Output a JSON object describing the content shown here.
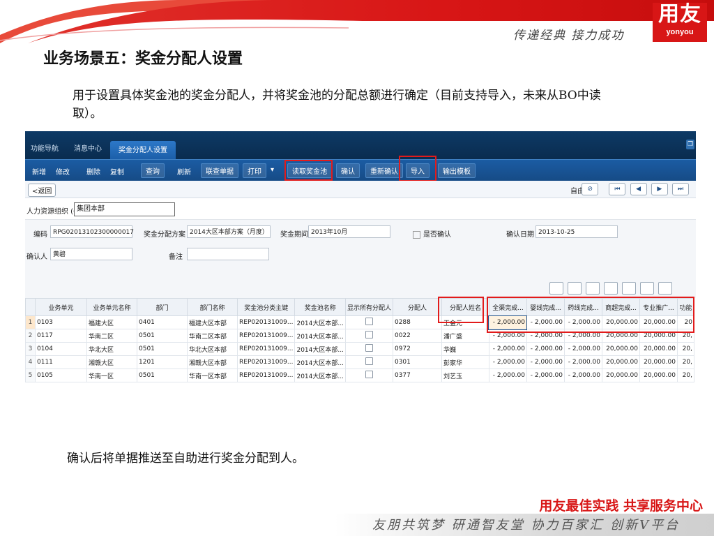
{
  "logo": {
    "cn": "用友",
    "en": "yonyou"
  },
  "slogan": "传递经典 接力成功",
  "title": "业务场景五：奖金分配人设置",
  "description": "用于设置具体奖金池的奖金分配人，并将奖金池的分配总额进行确定（目前支持导入，未来从BO中读取）。",
  "confirm_text": "确认后将单据推送至自助进行奖金分配到人。",
  "footer_red": "用友最佳实践  共享服务中心",
  "footer_motto": "友朋共筑梦 研通智友堂 协力百家汇 创新V平台",
  "app": {
    "tabs": [
      "功能导航",
      "消息中心",
      "奖金分配人设置"
    ],
    "toolbar": [
      "新增",
      "修改",
      "删除",
      "复制",
      "查询",
      "刷新",
      "联查单据",
      "打印",
      "读取奖金池",
      "确认",
      "重新确认",
      "导入",
      "输出模板"
    ],
    "toolbar_arrow": "▾",
    "back_label": "<返回",
    "free_label": "自由",
    "org_label": "人力资源组织 (O)",
    "org_value": "集团本部",
    "form": {
      "code_label": "编码",
      "code_value": "RPG02013102300000017",
      "plan_label": "奖金分配方案",
      "plan_value": "2014大区本部方案（月度）",
      "period_label": "奖金期间",
      "period_value": "2013年10月",
      "confirmed_label": "是否确认",
      "confirm_date_label": "确认日期",
      "confirm_date_value": "2013-10-25",
      "confirmer_label": "确认人",
      "confirmer_value": "黄碧",
      "remark_label": "备注"
    },
    "columns": [
      "业务单元",
      "业务单元名称",
      "部门",
      "部门名称",
      "奖金池分类主键",
      "奖金池名称",
      "显示所有分配人",
      "分配人",
      "分配人姓名",
      "全渠完成...",
      "婴线完成...",
      "药线完成...",
      "商超完成...",
      "专业推广...",
      "功能"
    ],
    "rows": [
      {
        "n": "1",
        "unit": "0103",
        "unit_name": "福建大区",
        "dept": "0401",
        "dept_name": "福建大区本部",
        "pool_key": "REP020131009...",
        "pool_name": "2014大区本部...",
        "assignee": "0288",
        "assignee_name": "王金元",
        "v": [
          "- 2,000.00",
          "- 2,000.00",
          "- 2,000.00",
          "20,000.00",
          "20,000.00",
          "20"
        ]
      },
      {
        "n": "2",
        "unit": "0117",
        "unit_name": "华南二区",
        "dept": "0501",
        "dept_name": "华南二区本部",
        "pool_key": "REP020131009...",
        "pool_name": "2014大区本部...",
        "assignee": "0022",
        "assignee_name": "潘广盛",
        "v": [
          "- 2,000.00",
          "- 2,000.00",
          "- 2,000.00",
          "20,000.00",
          "20,000.00",
          "20,"
        ]
      },
      {
        "n": "3",
        "unit": "0104",
        "unit_name": "华北大区",
        "dept": "0501",
        "dept_name": "华北大区本部",
        "pool_key": "REP020131009...",
        "pool_name": "2014大区本部...",
        "assignee": "0972",
        "assignee_name": "华巍",
        "v": [
          "- 2,000.00",
          "- 2,000.00",
          "- 2,000.00",
          "20,000.00",
          "20,000.00",
          "20,"
        ]
      },
      {
        "n": "4",
        "unit": "0111",
        "unit_name": "湘赣大区",
        "dept": "1201",
        "dept_name": "湘赣大区本部",
        "pool_key": "REP020131009...",
        "pool_name": "2014大区本部...",
        "assignee": "0301",
        "assignee_name": "彭家华",
        "v": [
          "- 2,000.00",
          "- 2,000.00",
          "- 2,000.00",
          "20,000.00",
          "20,000.00",
          "20,"
        ]
      },
      {
        "n": "5",
        "unit": "0105",
        "unit_name": "华南一区",
        "dept": "0501",
        "dept_name": "华南一区本部",
        "pool_key": "REP020131009...",
        "pool_name": "2014大区本部...",
        "assignee": "0377",
        "assignee_name": "刘艺玉",
        "v": [
          "- 2,000.00",
          "- 2,000.00",
          "- 2,000.00",
          "20,000.00",
          "20,000.00",
          "20,"
        ]
      }
    ]
  }
}
